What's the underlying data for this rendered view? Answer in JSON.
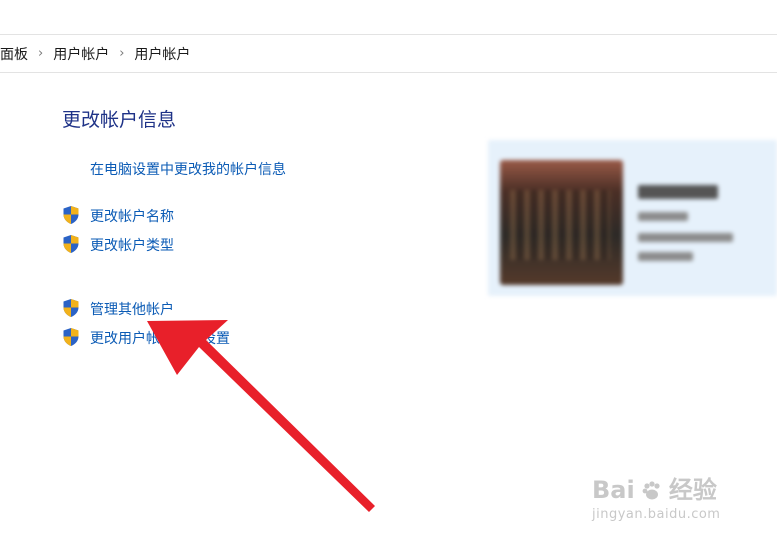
{
  "breadcrumb": {
    "items": [
      "面板",
      "用户帐户",
      "用户帐户"
    ],
    "separator": "›"
  },
  "page_title": "更改帐户信息",
  "links": {
    "pc_settings": "在电脑设置中更改我的帐户信息",
    "change_name": "更改帐户名称",
    "change_type": "更改帐户类型",
    "manage_other": "管理其他帐户",
    "change_uac": "更改用户帐户控制设置"
  },
  "watermark": {
    "brand_left": "Bai",
    "brand_right": "经验",
    "url": "jingyan.baidu.com"
  },
  "icons": {
    "shield": "uac-shield-icon",
    "arrow": "red-annotation-arrow"
  },
  "colors": {
    "link": "#0b5bb5",
    "title": "#1e3287",
    "arrow": "#e8202a",
    "preview_bg": "#e6f1fb"
  }
}
